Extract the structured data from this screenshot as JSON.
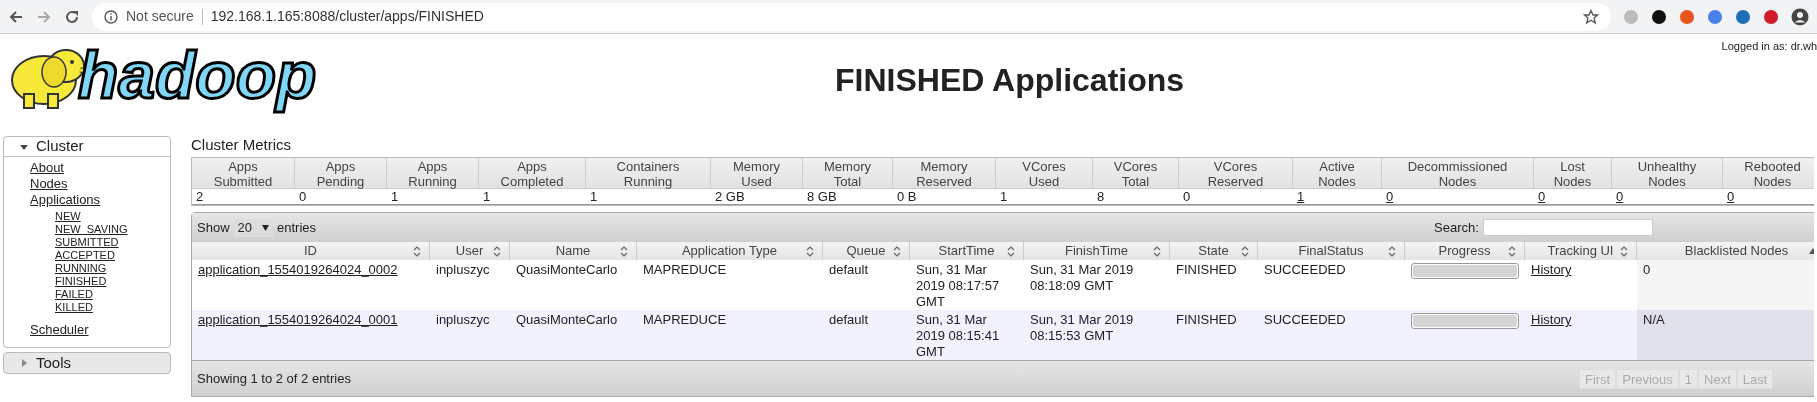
{
  "browser": {
    "security": "Not secure",
    "url": "192.168.1.165:8088/cluster/apps/FINISHED"
  },
  "logo": {
    "text": "hadoop"
  },
  "page_title": "FINISHED Applications",
  "login": "Logged in as: dr.wh",
  "sidebar": {
    "sections": [
      {
        "label": "Cluster",
        "expanded": true,
        "items": [
          {
            "label": "About"
          },
          {
            "label": "Nodes"
          },
          {
            "label": "Applications",
            "children": [
              {
                "label": "NEW"
              },
              {
                "label": "NEW_SAVING"
              },
              {
                "label": "SUBMITTED"
              },
              {
                "label": "ACCEPTED"
              },
              {
                "label": "RUNNING"
              },
              {
                "label": "FINISHED"
              },
              {
                "label": "FAILED"
              },
              {
                "label": "KILLED"
              }
            ]
          },
          {
            "label": "Scheduler"
          }
        ]
      },
      {
        "label": "Tools",
        "expanded": false
      }
    ]
  },
  "metrics": {
    "title": "Cluster Metrics",
    "columns": [
      {
        "header": [
          "Apps",
          "Submitted"
        ],
        "value": "2",
        "link": false
      },
      {
        "header": [
          "Apps",
          "Pending"
        ],
        "value": "0",
        "link": false
      },
      {
        "header": [
          "Apps",
          "Running"
        ],
        "value": "1",
        "link": false
      },
      {
        "header": [
          "Apps",
          "Completed"
        ],
        "value": "1",
        "link": false
      },
      {
        "header": [
          "Containers",
          "Running"
        ],
        "value": "1",
        "link": false
      },
      {
        "header": [
          "Memory",
          "Used"
        ],
        "value": "2 GB",
        "link": false
      },
      {
        "header": [
          "Memory",
          "Total"
        ],
        "value": "8 GB",
        "link": false
      },
      {
        "header": [
          "Memory",
          "Reserved"
        ],
        "value": "0 B",
        "link": false
      },
      {
        "header": [
          "VCores",
          "Used"
        ],
        "value": "1",
        "link": false
      },
      {
        "header": [
          "VCores",
          "Total"
        ],
        "value": "8",
        "link": false
      },
      {
        "header": [
          "VCores",
          "Reserved"
        ],
        "value": "0",
        "link": false
      },
      {
        "header": [
          "Active",
          "Nodes"
        ],
        "value": "1",
        "link": true
      },
      {
        "header": [
          "Decommissioned",
          "Nodes"
        ],
        "value": "0",
        "link": true
      },
      {
        "header": [
          "Lost",
          "Nodes"
        ],
        "value": "0",
        "link": true
      },
      {
        "header": [
          "Unhealthy",
          "Nodes"
        ],
        "value": "0",
        "link": true
      },
      {
        "header": [
          "Rebooted",
          "Nodes"
        ],
        "value": "0",
        "link": true
      }
    ]
  },
  "apps_table": {
    "show_label": "Show",
    "page_size": "20",
    "entries_label": "entries",
    "search_label": "Search:",
    "columns": [
      {
        "label": "ID",
        "sorted_ascending": false
      },
      {
        "label": "User",
        "sorted_ascending": false
      },
      {
        "label": "Name",
        "sorted_ascending": false
      },
      {
        "label": "Application Type",
        "sorted_ascending": false
      },
      {
        "label": "Queue",
        "sorted_ascending": false
      },
      {
        "label": "StartTime",
        "sorted_ascending": false
      },
      {
        "label": "FinishTime",
        "sorted_ascending": false
      },
      {
        "label": "State",
        "sorted_ascending": false
      },
      {
        "label": "FinalStatus",
        "sorted_ascending": false
      },
      {
        "label": "Progress",
        "sorted_ascending": false
      },
      {
        "label": "Tracking UI",
        "sorted_ascending": false
      },
      {
        "label": "Blacklisted Nodes",
        "sorted_ascending": true
      }
    ],
    "rows": [
      {
        "id": "application_1554019264024_0002",
        "user": "inpluszyc",
        "name": "QuasiMonteCarlo",
        "type": "MAPREDUCE",
        "queue": "default",
        "start": "Sun, 31 Mar 2019 08:17:57 GMT",
        "finish": "Sun, 31 Mar 2019 08:18:09 GMT",
        "state": "FINISHED",
        "final_status": "SUCCEEDED",
        "level": 1,
        "tracking": "History",
        "blacklisted": "0"
      },
      {
        "id": "application_1554019264024_0001",
        "user": "inpluszyc",
        "name": "QuasiMonteCarlo",
        "type": "MAPREDUCE",
        "queue": "default",
        "start": "Sun, 31 Mar 2019 08:15:41 GMT",
        "finish": "Sun, 31 Mar 2019 08:15:53 GMT",
        "state": "FINISHED",
        "final_status": "SUCCEEDED",
        "level": 1,
        "tracking": "History",
        "blacklisted": "N/A"
      }
    ],
    "info": "Showing 1 to 2 of 2 entries",
    "pagination": [
      {
        "label": "First",
        "disabled": true
      },
      {
        "label": "Previous",
        "disabled": true
      },
      {
        "label": "1",
        "disabled": true
      },
      {
        "label": "Next",
        "disabled": true
      },
      {
        "label": "Last",
        "disabled": true
      }
    ]
  }
}
